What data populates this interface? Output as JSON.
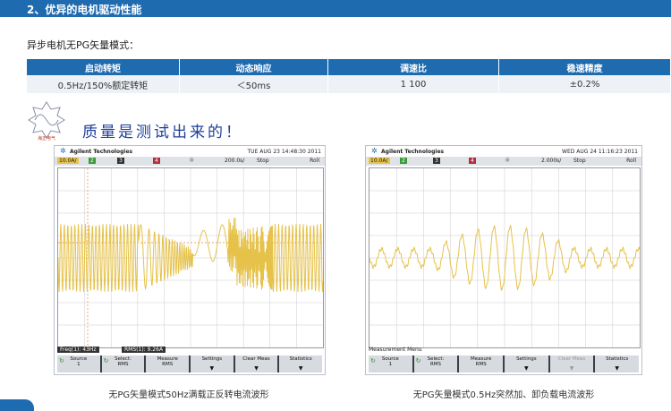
{
  "header": {
    "title": "2、优异的电机驱动性能"
  },
  "section": {
    "subtitle": "异步电机无PG矢量模式："
  },
  "spec_table": {
    "headers": [
      "启动转矩",
      "动态响应",
      "调速比",
      "稳速精度"
    ],
    "values": [
      "0.5Hz/150%额定转矩",
      "＜50ms",
      "1 100",
      "±0.2%"
    ]
  },
  "logo": {
    "text": "海正电气"
  },
  "slogan": "质量是测试出来的！",
  "scope_left": {
    "brand": "Agilent Technologies",
    "datetime": "TUE AUG 23 14:48:30 2011",
    "ch_scale": "10.0A/",
    "ch2": "2",
    "ch3": "3",
    "ch4": "4",
    "timebase": "200.0s/",
    "run_state": "Stop",
    "trigger": "Roll",
    "status_left": "Freq(1): 43Hz",
    "status_right": "RMS(1): 9.26A",
    "softkeys": [
      {
        "line1": "Source",
        "line2": "1"
      },
      {
        "line1": "Select:",
        "line2": "RMS"
      },
      {
        "line1": "Measure",
        "line2": "RMS"
      },
      {
        "line1": "Settings",
        "line2": ""
      },
      {
        "line1": "Clear Meas",
        "line2": ""
      },
      {
        "line1": "Statistics",
        "line2": ""
      }
    ]
  },
  "scope_right": {
    "brand": "Agilent Technologies",
    "datetime": "WED AUG 24 11:16:23 2011",
    "ch_scale": "10.0A/",
    "ch2": "2",
    "ch3": "3",
    "ch4": "4",
    "timebase": "2.000s/",
    "run_state": "Stop",
    "trigger": "Roll",
    "status_left": "Measurement Menu",
    "softkeys": [
      {
        "line1": "Source",
        "line2": "1"
      },
      {
        "line1": "Select:",
        "line2": "RMS"
      },
      {
        "line1": "Measure",
        "line2": "RMS"
      },
      {
        "line1": "Settings",
        "line2": ""
      },
      {
        "line1": "Clear Meas",
        "line2": ""
      },
      {
        "line1": "Statistics",
        "line2": ""
      }
    ]
  },
  "captions": {
    "left": "无PG矢量模式50Hz满载正反转电流波形",
    "right": "无PG矢量模式0.5Hz突然加、卸负载电流波形"
  },
  "colors": {
    "accent": "#1f6bb0",
    "waveform": "#e6c24a",
    "slogan": "#1f3f9a"
  }
}
